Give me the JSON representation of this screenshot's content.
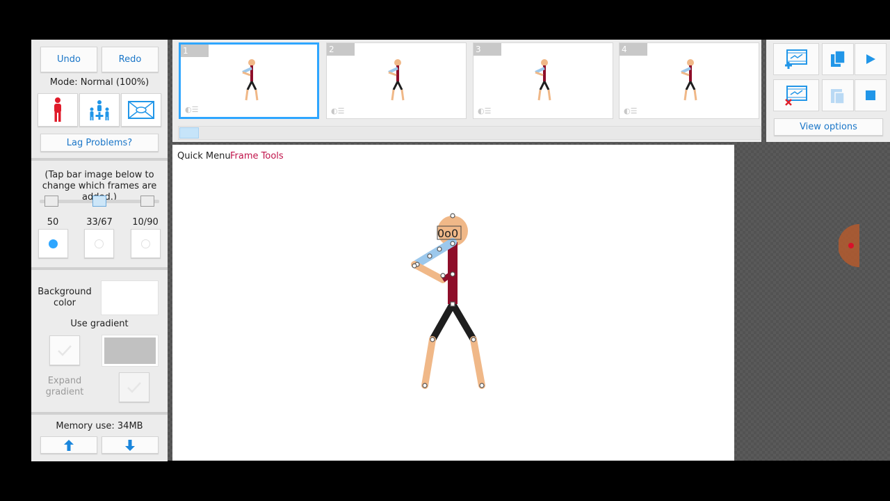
{
  "left_panel": {
    "undo_label": "Undo",
    "redo_label": "Redo",
    "mode_text": "Mode: Normal (100%)",
    "lag_label": "Lag Problems?",
    "tap_hint": "(Tap bar image below to change which frames are added.)",
    "ratios": [
      "50",
      "33/67",
      "10/90"
    ],
    "selected_ratio_index": 0,
    "background_color_label": "Background color",
    "background_color": "#ffffff",
    "use_gradient_label": "Use gradient",
    "gradient_color": "#c1c1c1",
    "expand_gradient_label": "Expand gradient",
    "memory_text": "Memory use: 34MB"
  },
  "timeline": {
    "frames": [
      {
        "number": "1",
        "selected": true
      },
      {
        "number": "2",
        "selected": false
      },
      {
        "number": "3",
        "selected": false
      },
      {
        "number": "4",
        "selected": false
      }
    ]
  },
  "right_panel": {
    "view_options_label": "View options"
  },
  "canvas": {
    "quick_menu_label": "Quick Menu",
    "frame_tools_label": "Frame Tools",
    "face_text": "0o0"
  },
  "colors": {
    "accent": "#1a76c8",
    "selection": "#2ea6ff",
    "frame_tools": "#c0134a",
    "shirt": "#8e0e2a",
    "skin": "#f0b888",
    "sleeve": "#9cc8ec",
    "pants": "#1e1e1e"
  }
}
